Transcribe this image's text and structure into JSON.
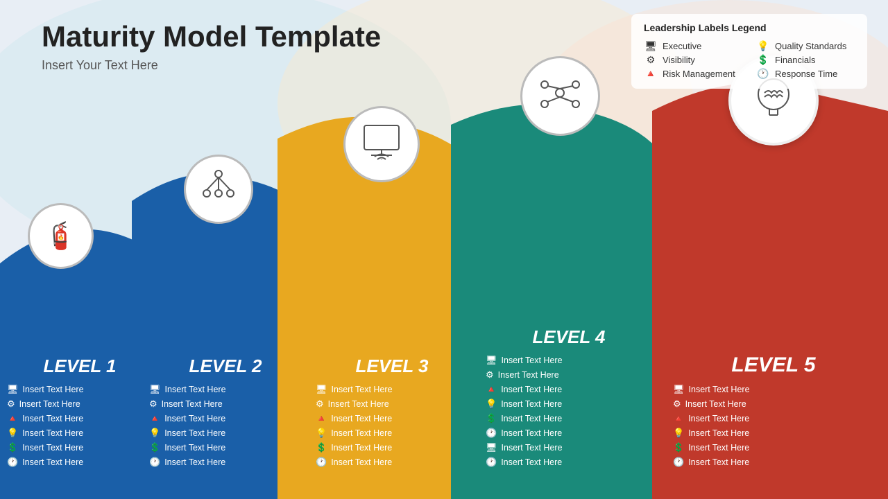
{
  "header": {
    "title": "Maturity Model Template",
    "subtitle": "Insert Your Text Here"
  },
  "legend": {
    "title": "Leadership Labels Legend",
    "left_items": [
      {
        "icon": "🖥",
        "label": "Executive"
      },
      {
        "icon": "⚙",
        "label": "Visibility"
      },
      {
        "icon": "🔺",
        "label": "Risk Management"
      }
    ],
    "right_items": [
      {
        "icon": "💡",
        "label": "Quality Standards"
      },
      {
        "icon": "💲",
        "label": "Financials"
      },
      {
        "icon": "🕐",
        "label": "Response Time"
      }
    ]
  },
  "levels": [
    {
      "id": "level1",
      "label": "LEVEL 1",
      "color": "#1a5fa8",
      "icon": "🧯",
      "items": [
        {
          "icon": "🖥",
          "text": "Insert Text Here"
        },
        {
          "icon": "⚙",
          "text": "Insert Text Here"
        },
        {
          "icon": "🔺",
          "text": "Insert Text Here"
        },
        {
          "icon": "💡",
          "text": "Insert Text Here"
        },
        {
          "icon": "💲",
          "text": "Insert Text Here"
        },
        {
          "icon": "🕐",
          "text": "Insert Text Here"
        }
      ]
    },
    {
      "id": "level2",
      "label": "LEVEL 2",
      "color": "#1a5fa8",
      "icon": "🔗",
      "items": [
        {
          "icon": "🖥",
          "text": "Insert Text Here"
        },
        {
          "icon": "⚙",
          "text": "Insert Text Here"
        },
        {
          "icon": "🔺",
          "text": "Insert Text Here"
        },
        {
          "icon": "💡",
          "text": "Insert Text Here"
        },
        {
          "icon": "💲",
          "text": "Insert Text Here"
        },
        {
          "icon": "🕐",
          "text": "Insert Text Here"
        }
      ]
    },
    {
      "id": "level3",
      "label": "LEVEL 3",
      "color": "#e8a820",
      "icon": "🖥",
      "items": [
        {
          "icon": "🖥",
          "text": "Insert Text Here"
        },
        {
          "icon": "⚙",
          "text": "Insert Text Here"
        },
        {
          "icon": "🔺",
          "text": "Insert Text Here"
        },
        {
          "icon": "💡",
          "text": "Insert Text Here"
        },
        {
          "icon": "💲",
          "text": "Insert Text Here"
        },
        {
          "icon": "🕐",
          "text": "Insert Text Here"
        }
      ]
    },
    {
      "id": "level4",
      "label": "LEVEL 4",
      "color": "#1a8a7a",
      "icon": "🔵",
      "items": [
        {
          "icon": "🖥",
          "text": "Insert Text Here"
        },
        {
          "icon": "⚙",
          "text": "Insert Text Here"
        },
        {
          "icon": "🔺",
          "text": "Insert Text Here"
        },
        {
          "icon": "💡",
          "text": "Insert Text Here"
        },
        {
          "icon": "💲",
          "text": "Insert Text Here"
        },
        {
          "icon": "🕐",
          "text": "Insert Text Here"
        },
        {
          "icon": "🖥",
          "text": "Insert Text Here"
        },
        {
          "icon": "🕐",
          "text": "Insert Text Here"
        }
      ]
    },
    {
      "id": "level5",
      "label": "LEVEL 5",
      "color": "#c0392b",
      "icon": "🧠",
      "items": [
        {
          "icon": "🖥",
          "text": "Insert Text Here"
        },
        {
          "icon": "⚙",
          "text": "Insert Text Here"
        },
        {
          "icon": "🔺",
          "text": "Insert Text Here"
        },
        {
          "icon": "💡",
          "text": "Insert Text Here"
        },
        {
          "icon": "💲",
          "text": "Insert Text Here"
        },
        {
          "icon": "🕐",
          "text": "Insert Text Here"
        }
      ]
    }
  ]
}
